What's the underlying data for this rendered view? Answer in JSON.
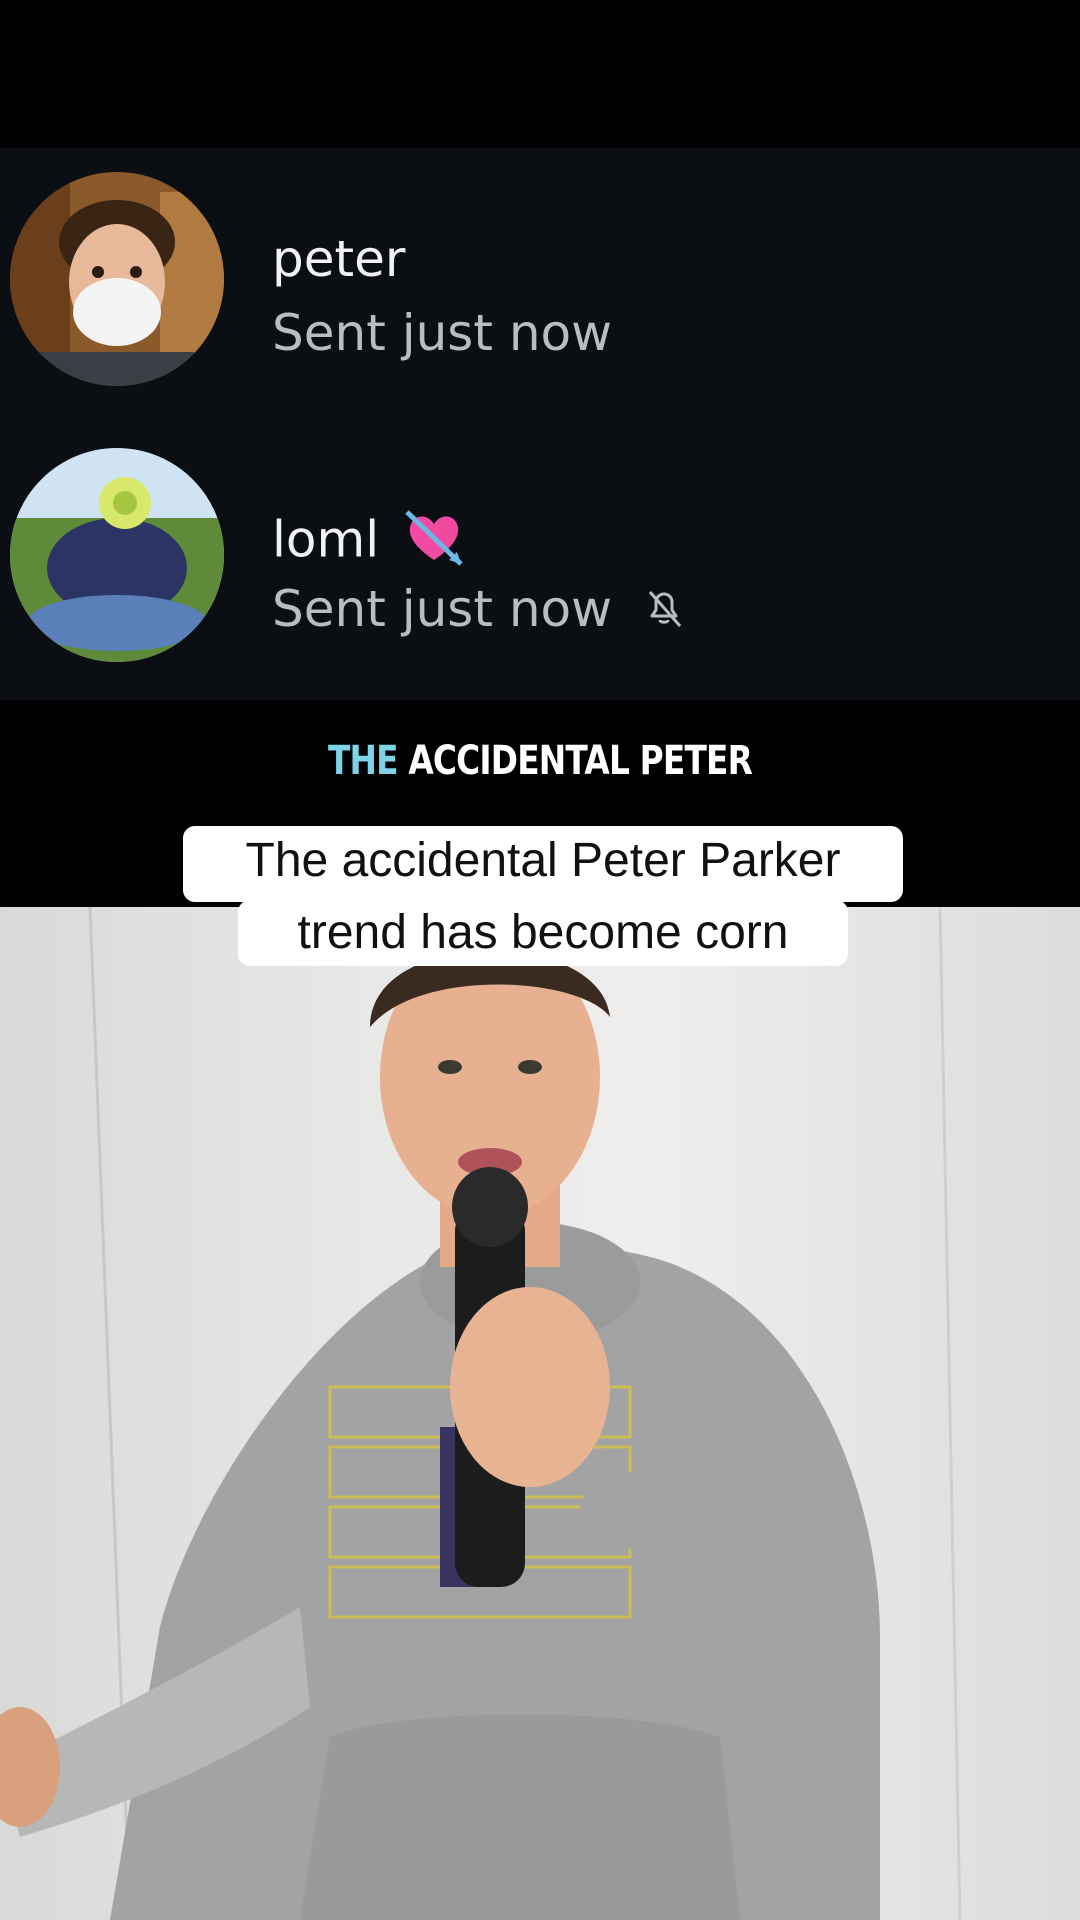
{
  "messages": [
    {
      "name": "peter",
      "status": "Sent just now",
      "avatar_icon": "avatar-shaving-cream"
    },
    {
      "name": "loml",
      "status": "Sent just now",
      "name_emoji": "heart-with-arrow-icon",
      "status_icon": "bell-off-icon",
      "avatar_icon": "avatar-flower-face"
    }
  ],
  "headline": {
    "accent": "THE",
    "rest": "ACCIDENTAL PETER"
  },
  "caption": {
    "line1": "The accidental Peter Parker",
    "line2": "trend has become corn"
  },
  "colors": {
    "accent": "#7fd3e6",
    "panel_bg": "#0b0f14",
    "text_secondary": "#b9bcc0"
  }
}
